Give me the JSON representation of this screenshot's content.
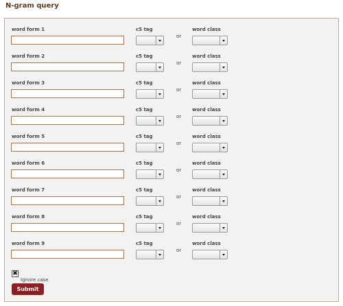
{
  "title": "N-gram query",
  "labels": {
    "c5": "c5 tag",
    "or": "or",
    "word_class": "word class"
  },
  "rows": [
    {
      "word_label": "word form 1",
      "word_value": "",
      "c5_value": "",
      "class_value": ""
    },
    {
      "word_label": "word form 2",
      "word_value": "",
      "c5_value": "",
      "class_value": ""
    },
    {
      "word_label": "word form 3",
      "word_value": "",
      "c5_value": "",
      "class_value": ""
    },
    {
      "word_label": "word form 4",
      "word_value": "",
      "c5_value": "",
      "class_value": ""
    },
    {
      "word_label": "word form 5",
      "word_value": "",
      "c5_value": "",
      "class_value": ""
    },
    {
      "word_label": "word form 6",
      "word_value": "",
      "c5_value": "",
      "class_value": ""
    },
    {
      "word_label": "word form 7",
      "word_value": "",
      "c5_value": "",
      "class_value": ""
    },
    {
      "word_label": "word form 8",
      "word_value": "",
      "c5_value": "",
      "class_value": ""
    },
    {
      "word_label": "word form 9",
      "word_value": "",
      "c5_value": "",
      "class_value": ""
    }
  ],
  "ignore_case": {
    "label": "Ignore case",
    "checked": true,
    "mark": "✖"
  },
  "submit_label": "Submit"
}
